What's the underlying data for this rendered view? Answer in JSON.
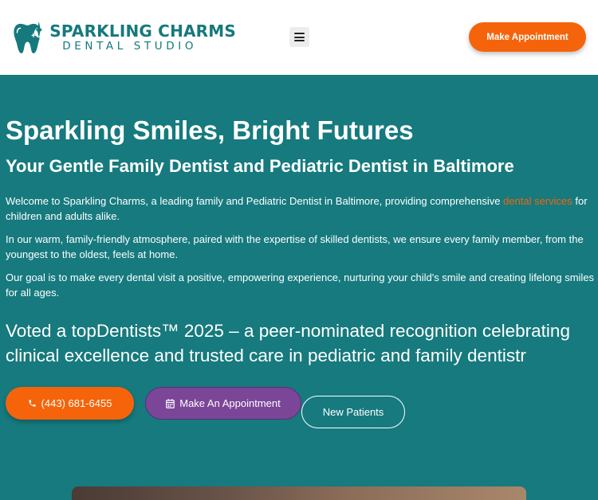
{
  "brand": {
    "name": "SPARKLING CHARMS",
    "sub": "DENTAL STUDIO",
    "primary_color": "#15797d"
  },
  "header": {
    "menu_icon": "hamburger-menu-icon",
    "cta_label": "Make Appointment",
    "cta_color": "#f5640b"
  },
  "hero": {
    "background": "#167a7e",
    "title": "Sparkling Smiles, Bright Futures",
    "subtitle": "Your Gentle Family Dentist and Pediatric Dentist in Baltimore",
    "p1_before": "Welcome to Sparkling Charms, a leading family and Pediatric Dentist in Baltimore, providing comprehensive ",
    "p1_link": "dental services",
    "p1_after": " for children and adults alike.",
    "p2": "In our warm, family-friendly atmosphere, paired with the expertise of skilled dentists, we ensure every family member, from the youngest to the oldest, feels at home.",
    "p3": "Our goal is to make every dental visit a positive, empowering experience, nurturing your child's smile and creating lifelong smiles for all ages.",
    "voted": "Voted a topDentists™ 2025 – a peer-nominated recognition celebrating clinical excellence and trusted care in pediatric and family dentistr",
    "buttons": {
      "phone_label": "(443) 681-6455",
      "phone_icon": "phone-icon",
      "appointment_label": "Make An Appointment",
      "appointment_icon": "calendar-icon",
      "new_patients_label": "New Patients"
    }
  }
}
